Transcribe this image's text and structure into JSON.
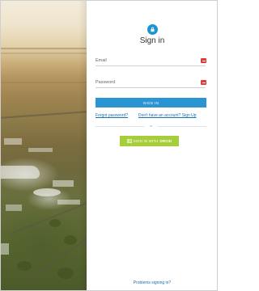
{
  "form": {
    "title": "Sign in",
    "email_placeholder": "Email",
    "password_placeholder": "Password",
    "signin_label": "SIGN IN",
    "forgot_label": "Forgot password?",
    "signup_label": "Don't have an account? Sign Up",
    "or_label": "or",
    "orcid_label_prefix": "SIGN IN WITH",
    "orcid_label_brand": "ORCID",
    "problems_label": "Problems signing in?"
  },
  "icons": {
    "lock": "lock-icon",
    "error": "error-icon",
    "orcid": "orcid-id-icon"
  },
  "colors": {
    "primary": "#2b95d3",
    "orcid": "#a6ce39",
    "error": "#e03a3a",
    "link": "#1a6fb0"
  }
}
